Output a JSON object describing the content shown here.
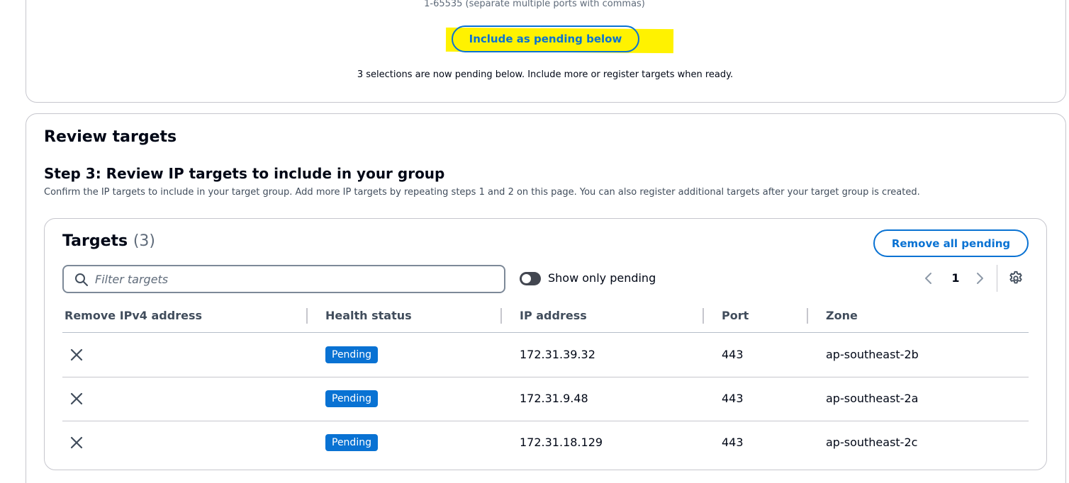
{
  "previous_step": {
    "port_hint": "1-65535 (separate multiple ports with commas)",
    "include_button": "Include as pending below",
    "pending_note": "3 selections are now pending below. Include more or register targets when ready."
  },
  "review": {
    "title": "Review targets",
    "step_title": "Step 3: Review IP targets to include in your group",
    "step_description": "Confirm the IP targets to include in your target group. Add more IP targets by repeating steps 1 and 2 on this page. You can also register additional targets after your target group is created."
  },
  "targets": {
    "heading": "Targets",
    "count": "(3)",
    "remove_all_button": "Remove all pending",
    "filter_placeholder": "Filter targets",
    "toggle_label": "Show only pending",
    "toggle_on": false,
    "page": "1",
    "columns": [
      "Remove IPv4 address",
      "Health status",
      "IP address",
      "Port",
      "Zone"
    ],
    "rows": [
      {
        "health": "Pending",
        "ip": "172.31.39.32",
        "port": "443",
        "zone": "ap-southeast-2b"
      },
      {
        "health": "Pending",
        "ip": "172.31.9.48",
        "port": "443",
        "zone": "ap-southeast-2a"
      },
      {
        "health": "Pending",
        "ip": "172.31.18.129",
        "port": "443",
        "zone": "ap-southeast-2c"
      }
    ]
  },
  "colors": {
    "accent": "#0972d3",
    "highlight": "#fff200",
    "badge": "#0972d3"
  },
  "icons": [
    "search-icon",
    "close-icon",
    "chevron-left-icon",
    "chevron-right-icon",
    "gear-icon"
  ]
}
